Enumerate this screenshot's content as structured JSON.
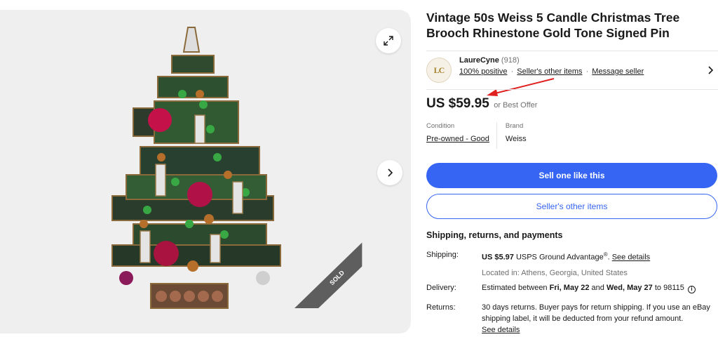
{
  "listing": {
    "title": "Vintage 50s Weiss 5 Candle Christmas Tree Brooch Rhinestone Gold Tone Signed Pin",
    "sold_ribbon": "SOLD",
    "expand_icon": "expand-icon",
    "next_icon": "chevron-right-icon"
  },
  "seller": {
    "logo_text": "LC",
    "name": "LaureCyne",
    "feedback_count": "(918)",
    "positive": "100% positive",
    "other_items": "Seller's other items",
    "message": "Message seller",
    "separator": "·"
  },
  "price": {
    "amount": "US $59.95",
    "offer": "or Best Offer"
  },
  "details": {
    "condition_label": "Condition",
    "condition_value": "Pre-owned - Good",
    "brand_label": "Brand",
    "brand_value": "Weiss"
  },
  "actions": {
    "sell_one": "Sell one like this",
    "sellers_other": "Seller's other items"
  },
  "shipping": {
    "heading": "Shipping, returns, and payments",
    "shipping_label": "Shipping:",
    "shipping_price": "US $5.97",
    "shipping_service": "USPS Ground Advantage",
    "shipping_reg": "®",
    "see_details": "See details",
    "located": "Located in: Athens, Georgia, United States",
    "delivery_label": "Delivery:",
    "delivery_pre": "Estimated between",
    "delivery_start": "Fri, May 22",
    "delivery_and": "and",
    "delivery_end": "Wed, May 27",
    "delivery_to": "to 98115",
    "info_glyph": "i",
    "returns_label": "Returns:",
    "returns_text": "30 days returns. Buyer pays for return shipping. If you use an eBay shipping label, it will be deducted from your refund amount.",
    "returns_link": "See details"
  },
  "colors": {
    "primary": "#3665f3",
    "annotation": "#e0201f"
  }
}
